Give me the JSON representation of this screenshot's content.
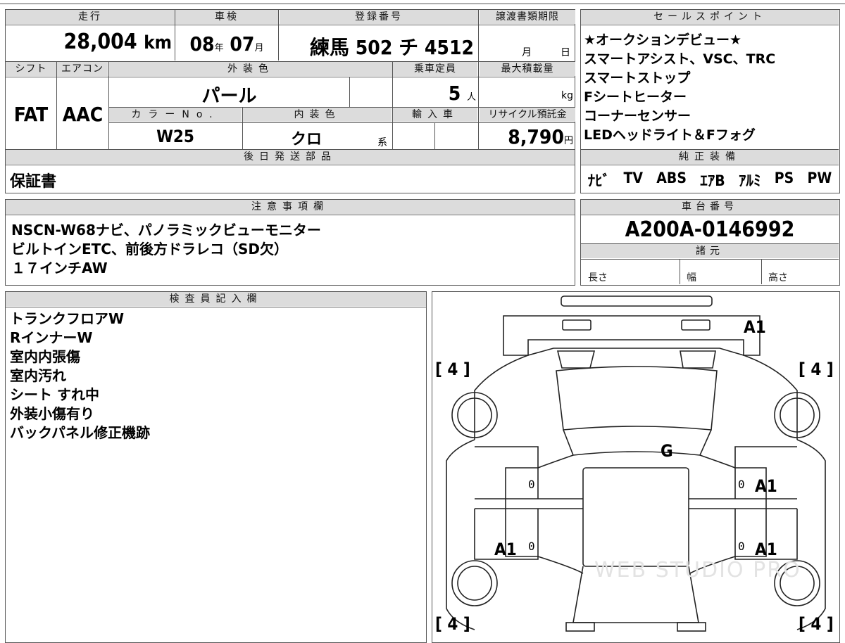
{
  "mileage": {
    "label": "走行",
    "value": "28,004",
    "unit": "km"
  },
  "inspection": {
    "label": "車検",
    "year": "08",
    "year_unit": "年",
    "month": "07",
    "month_unit": "月"
  },
  "registration": {
    "label": "登録番号",
    "value": "練馬 502 チ 4512"
  },
  "transfer": {
    "label": "譲渡書類期限",
    "month_unit": "月",
    "day_unit": "日"
  },
  "sales_points": {
    "label": "セールスポイント",
    "items": [
      "★オークションデビュー★",
      "スマートアシスト、VSC、TRC",
      "スマートストップ",
      "Fシートヒーター",
      "コーナーセンサー",
      "LEDヘッドライト＆Fフォグ"
    ]
  },
  "shift": {
    "label": "シフト",
    "value": "FAT"
  },
  "aircon": {
    "label": "エアコン",
    "value": "AAC"
  },
  "exterior_color": {
    "label": "外装色",
    "value": "パール"
  },
  "capacity": {
    "label": "乗車定員",
    "value": "5",
    "unit": "人"
  },
  "max_load": {
    "label": "最大積載量",
    "unit": "kg"
  },
  "color_no": {
    "label": "カラーNo.",
    "value": "W25"
  },
  "interior_color": {
    "label": "内装色",
    "value": "クロ",
    "suffix": "系"
  },
  "import": {
    "label": "輸入車"
  },
  "recycle": {
    "label": "リサイクル預託金",
    "value": "8,790",
    "unit": "円"
  },
  "later_parts": {
    "label": "後日発送部品",
    "value": "保証書"
  },
  "genuine_equipment": {
    "label": "純正装備",
    "items": [
      "ﾅﾋﾞ",
      "TV",
      "ABS",
      "ｴｱB",
      "ｱﾙﾐ",
      "PS",
      "PW"
    ]
  },
  "notes": {
    "label": "注意事項欄",
    "lines": [
      "NSCN-W68ナビ、パノラミックビューモニター",
      "ビルトインETC、前後方ドラレコ（SD欠）",
      "１７インチAW"
    ]
  },
  "chassis": {
    "label": "車台番号",
    "value": "A200A-0146992"
  },
  "specs": {
    "label": "諸元",
    "length": "長さ",
    "width": "幅",
    "height": "高さ"
  },
  "inspector": {
    "label": "検査員記入欄",
    "lines": [
      "トランクフロアW",
      "RインナーW",
      "室内内張傷",
      "室内汚れ",
      "シート すれ中",
      "外装小傷有り",
      "バックパネル修正機跡"
    ]
  },
  "diagram": {
    "marks": {
      "rear": "A1",
      "roof": "G",
      "right_rear_door": "A1",
      "left_front_door": "A1",
      "right_front_door": "A1"
    },
    "tires": {
      "rear_left": "4",
      "rear_right": "4",
      "front_left": "4",
      "front_right": "4"
    },
    "door_marks": [
      "0",
      "0",
      "0",
      "0"
    ],
    "watermark": "WEB STUDIO PRO"
  }
}
